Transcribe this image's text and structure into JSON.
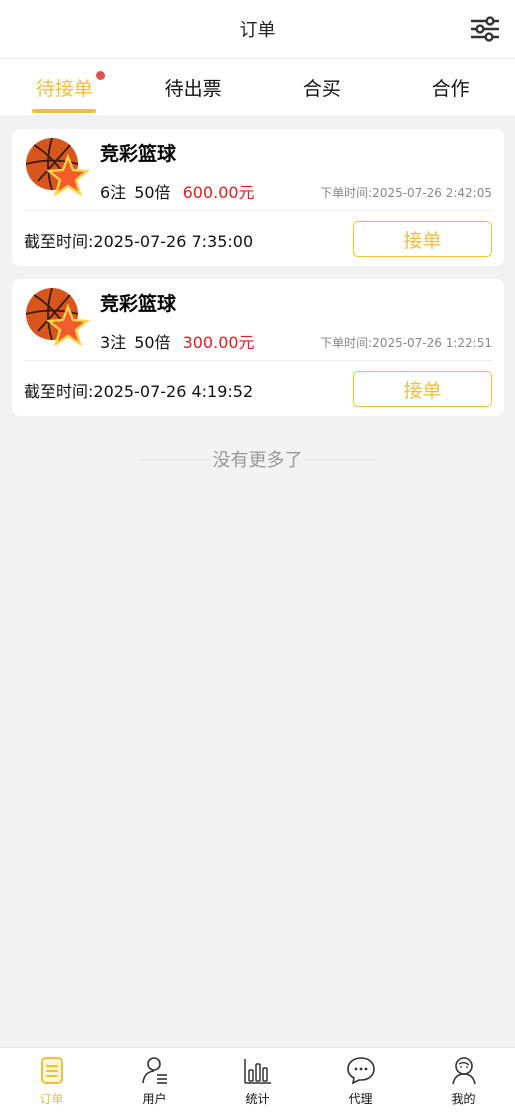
{
  "header": {
    "title": "订单",
    "filter_icon": "sliders-icon"
  },
  "tabs": [
    {
      "label": "待接单",
      "active": true,
      "has_dot": true
    },
    {
      "label": "待出票",
      "active": false
    },
    {
      "label": "合买",
      "active": false
    },
    {
      "label": "合作",
      "active": false
    }
  ],
  "orders": [
    {
      "title": "竞彩篮球",
      "bets": "6注",
      "multiplier": "50倍",
      "amount": "600.00元",
      "order_time": "下单时间:2025-07-26 2:42:05",
      "deadline": "截至时间:2025-07-26 7:35:00",
      "action": "接单",
      "logo_icon": "basketball-star-logo"
    },
    {
      "title": "竞彩篮球",
      "bets": "3注",
      "multiplier": "50倍",
      "amount": "300.00元",
      "order_time": "下单时间:2025-07-26 1:22:51",
      "deadline": "截至时间:2025-07-26 4:19:52",
      "action": "接单",
      "logo_icon": "basketball-star-logo"
    }
  ],
  "no_more": "没有更多了",
  "bottom_nav": [
    {
      "label": "订单",
      "icon": "order-doc-icon",
      "active": true
    },
    {
      "label": "用户",
      "icon": "user-list-icon",
      "active": false
    },
    {
      "label": "统计",
      "icon": "bar-stats-icon",
      "active": false
    },
    {
      "label": "代理",
      "icon": "chat-bubble-icon",
      "active": false
    },
    {
      "label": "我的",
      "icon": "profile-icon",
      "active": false
    }
  ],
  "colors": {
    "accent": "#f2bf3a",
    "amount": "#e81c1c",
    "background": "#f3f2f3"
  }
}
